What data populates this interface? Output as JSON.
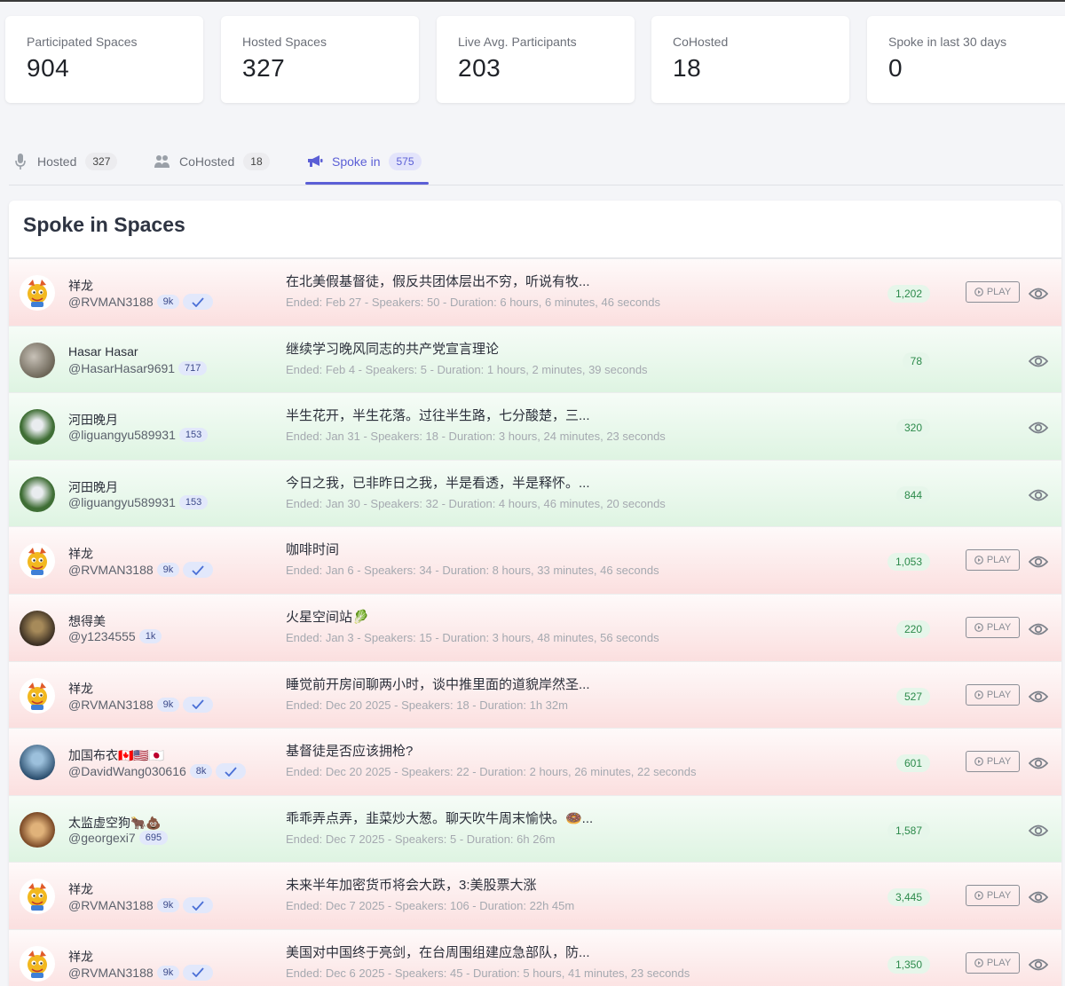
{
  "stats": [
    {
      "label": "Participated Spaces",
      "value": "904"
    },
    {
      "label": "Hosted Spaces",
      "value": "327"
    },
    {
      "label": "Live Avg. Participants",
      "value": "203"
    },
    {
      "label": "CoHosted",
      "value": "18"
    },
    {
      "label": "Spoke in last 30 days",
      "value": "0"
    }
  ],
  "tabs": [
    {
      "label": "Hosted",
      "count": "327",
      "icon": "microphone-icon"
    },
    {
      "label": "CoHosted",
      "count": "18",
      "icon": "users-icon"
    },
    {
      "label": "Spoke in",
      "count": "575",
      "icon": "megaphone-icon",
      "active": true
    }
  ],
  "panel": {
    "title": "Spoke in Spaces"
  },
  "colors": {
    "accent": "#5b5fd6",
    "row_red": "#fbdfdf",
    "row_green": "#def4e2",
    "count_green": "#2c8a4b"
  },
  "play_label": "PLAY",
  "rows": [
    {
      "name": "祥龙",
      "handle": "@RVMAN3188",
      "followers": "9k",
      "verified": true,
      "title": "在北美假基督徒，假反共团体层出不穷，听说有牧...",
      "meta": "Ended: Feb 27 - Speakers: 50 - Duration: 6 hours, 6 minutes, 46 seconds",
      "listeners": "1,202",
      "playable": true,
      "tone": "red",
      "avatar": "dragon"
    },
    {
      "name": "Hasar Hasar",
      "handle": "@HasarHasar9691",
      "followers": "717",
      "verified": false,
      "title": "继续学习晚风同志的共产党宣言理论",
      "meta": "Ended: Feb 4 - Speakers: 5 - Duration: 1 hours, 2 minutes, 39 seconds",
      "listeners": "78",
      "playable": false,
      "tone": "green",
      "avatar": "photo1"
    },
    {
      "name": "河田晚月",
      "handle": "@liguangyu589931",
      "followers": "153",
      "verified": false,
      "title": "半生花开，半生花落。过往半生路，七分酸楚，三...",
      "meta": "Ended: Jan 31 - Speakers: 18 - Duration: 3 hours, 24 minutes, 23 seconds",
      "listeners": "320",
      "playable": false,
      "tone": "green",
      "avatar": "photo2"
    },
    {
      "name": "河田晚月",
      "handle": "@liguangyu589931",
      "followers": "153",
      "verified": false,
      "title": "今日之我，已非昨日之我，半是看透，半是释怀。...",
      "meta": "Ended: Jan 30 - Speakers: 32 - Duration: 4 hours, 46 minutes, 20 seconds",
      "listeners": "844",
      "playable": false,
      "tone": "green",
      "avatar": "photo2"
    },
    {
      "name": "祥龙",
      "handle": "@RVMAN3188",
      "followers": "9k",
      "verified": true,
      "title": "咖啡时间",
      "meta": "Ended: Jan 6 - Speakers: 34 - Duration: 8 hours, 33 minutes, 46 seconds",
      "listeners": "1,053",
      "playable": true,
      "tone": "red",
      "avatar": "dragon"
    },
    {
      "name": "想得美",
      "handle": "@y1234555",
      "followers": "1k",
      "verified": false,
      "title": "火星空间站🥬",
      "meta": "Ended: Jan 3 - Speakers: 15 - Duration: 3 hours, 48 minutes, 56 seconds",
      "listeners": "220",
      "playable": true,
      "tone": "red",
      "avatar": "photo3"
    },
    {
      "name": "祥龙",
      "handle": "@RVMAN3188",
      "followers": "9k",
      "verified": true,
      "title": "睡觉前开房间聊两小时，谈中推里面的道貌岸然圣...",
      "meta": "Ended: Dec 20 2025 - Speakers: 18 - Duration: 1h 32m",
      "listeners": "527",
      "playable": true,
      "tone": "red",
      "avatar": "dragon"
    },
    {
      "name": "加国布衣🇨🇦🇺🇸🇯🇵",
      "handle": "@DavidWang030616",
      "followers": "8k",
      "verified": true,
      "title": "基督徒是否应该拥枪?",
      "meta": "Ended: Dec 20 2025 - Speakers: 22 - Duration: 2 hours, 26 minutes, 22 seconds",
      "listeners": "601",
      "playable": true,
      "tone": "red",
      "avatar": "photo4"
    },
    {
      "name": "太监虚空狗🐂💩",
      "handle": "@georgexi7",
      "followers": "695",
      "verified": false,
      "title": "乖乖弄点弄，韭菜炒大葱。聊天吹牛周末愉快。🍩...",
      "meta": "Ended: Dec 7 2025 - Speakers: 5 - Duration: 6h 26m",
      "listeners": "1,587",
      "playable": false,
      "tone": "green",
      "avatar": "mask"
    },
    {
      "name": "祥龙",
      "handle": "@RVMAN3188",
      "followers": "9k",
      "verified": true,
      "title": "未来半年加密货币将会大跌，3:美股票大涨",
      "meta": "Ended: Dec 7 2025 - Speakers: 106 - Duration: 22h 45m",
      "listeners": "3,445",
      "playable": true,
      "tone": "red",
      "avatar": "dragon"
    },
    {
      "name": "祥龙",
      "handle": "@RVMAN3188",
      "followers": "9k",
      "verified": true,
      "title": "美国对中国终于亮剑，在台周围组建应急部队，防...",
      "meta": "Ended: Dec 6 2025 - Speakers: 45 - Duration: 5 hours, 41 minutes, 23 seconds",
      "listeners": "1,350",
      "playable": true,
      "tone": "red",
      "avatar": "dragon"
    }
  ]
}
